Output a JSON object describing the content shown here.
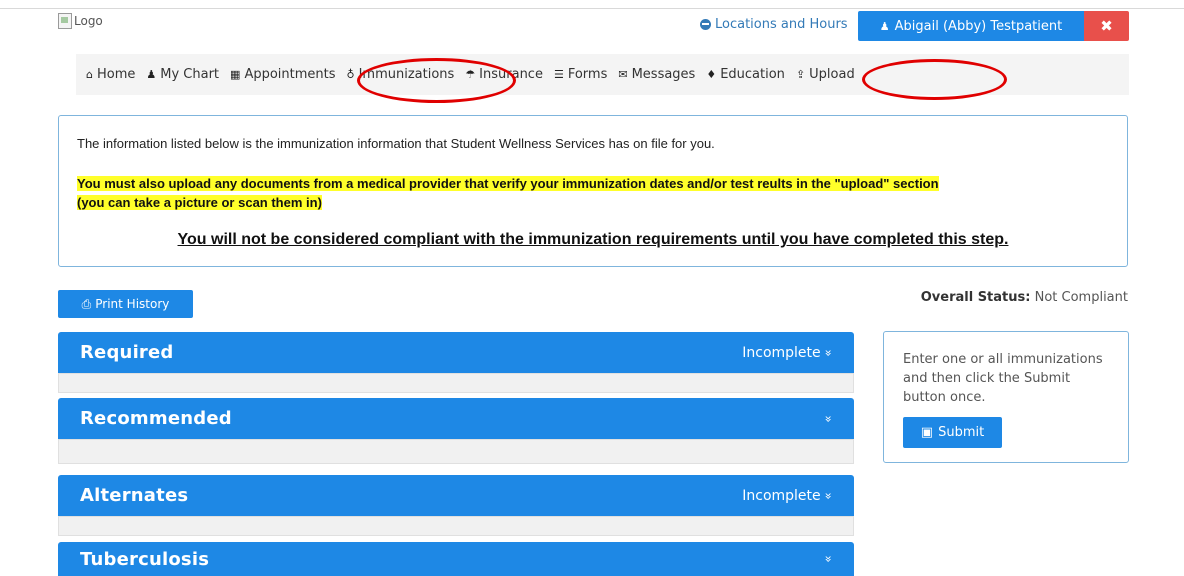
{
  "header": {
    "logo_alt": "Logo",
    "locations_link": "Locations and Hours",
    "user_name": "Abigail (Abby) Testpatient",
    "close_glyph": "✖"
  },
  "nav": {
    "items": [
      {
        "label": "Home",
        "icon": "home-icon",
        "glyph": "⌂"
      },
      {
        "label": "My Chart",
        "icon": "user-icon",
        "glyph": "♟"
      },
      {
        "label": "Appointments",
        "icon": "calendar-icon",
        "glyph": "▦"
      },
      {
        "label": "Immunizations",
        "icon": "stethoscope-icon",
        "glyph": "♁"
      },
      {
        "label": "Insurance",
        "icon": "umbrella-icon",
        "glyph": "☂"
      },
      {
        "label": "Forms",
        "icon": "list-icon",
        "glyph": "☰"
      },
      {
        "label": "Messages",
        "icon": "envelope-icon",
        "glyph": "✉"
      },
      {
        "label": "Education",
        "icon": "bell-icon",
        "glyph": "♦"
      },
      {
        "label": "Upload",
        "icon": "upload-icon",
        "glyph": "⇪"
      }
    ]
  },
  "notice": {
    "line1": "The information listed below is the immunization information that Student Wellness Services has on file for you.",
    "highlight_line1": "You must also upload any documents from a medical provider that verify your immunization dates and/or test reults in the \"upload\" section",
    "highlight_line2": "(you can take a picture or scan them in)",
    "compliance": "You will not be considered compliant with the immunization requirements until you have completed this step."
  },
  "actions": {
    "print_label": "Print History",
    "status_label": "Overall Status:",
    "status_value": "Not Compliant"
  },
  "sections": [
    {
      "title": "Required",
      "status": "Incomplete"
    },
    {
      "title": "Recommended",
      "status": ""
    },
    {
      "title": "Alternates",
      "status": "Incomplete"
    },
    {
      "title": "Tuberculosis",
      "status": ""
    }
  ],
  "side_panel": {
    "text": "Enter one or all immunizations and then click the Submit button once.",
    "submit_label": "Submit"
  },
  "colors": {
    "primary": "#1e88e5",
    "danger": "#e8504b",
    "highlight": "#ffff2a",
    "annotation": "#e00000"
  }
}
